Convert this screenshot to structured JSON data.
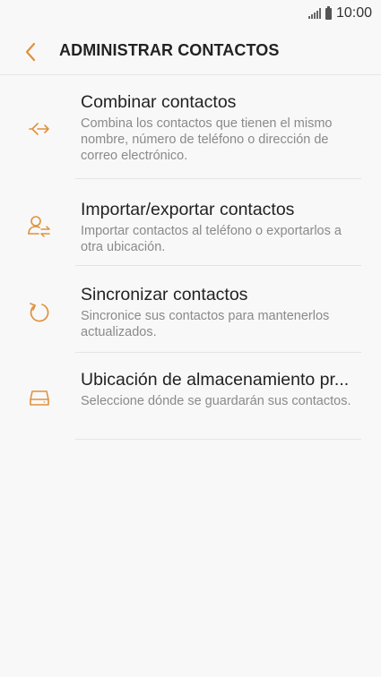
{
  "status_bar": {
    "time": "10:00",
    "signal_icon": "signal-icon",
    "battery_icon": "battery-icon"
  },
  "header": {
    "title": "ADMINISTRAR CONTACTOS",
    "back_icon": "chevron-left-icon"
  },
  "colors": {
    "accent": "#e0913c",
    "background": "#f8f8f8",
    "title_text": "#222222",
    "description_text": "#8a8a8a"
  },
  "items": [
    {
      "icon": "merge-icon",
      "title": "Combinar contactos",
      "description": "Combina los contactos que tienen el mismo nombre, número de teléfono o dirección de correo electrónico."
    },
    {
      "icon": "import-export-icon",
      "title": "Importar/exportar contactos",
      "description": "Importar contactos al teléfono o exportarlos a otra ubicación."
    },
    {
      "icon": "sync-icon",
      "title": "Sincronizar contactos",
      "description": "Sincronice sus contactos para mantenerlos actualizados."
    },
    {
      "icon": "storage-icon",
      "title": "Ubicación de almacenamiento pr...",
      "description": "Seleccione dónde se guardarán sus contactos."
    }
  ]
}
